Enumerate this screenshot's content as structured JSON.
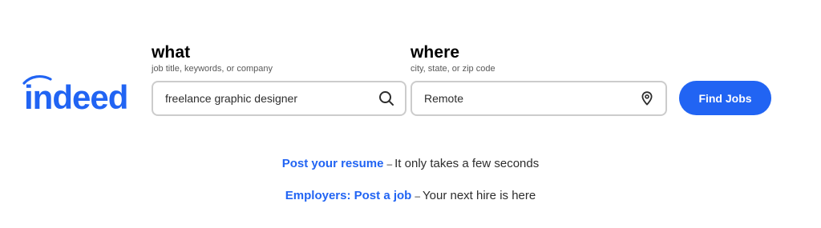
{
  "brand": {
    "logo_text": "indeed",
    "color": "#2164f3"
  },
  "search": {
    "what": {
      "label": "what",
      "hint": "job title, keywords, or company",
      "value": "freelance graphic designer",
      "icon": "search-icon"
    },
    "where": {
      "label": "where",
      "hint": "city, state, or zip code",
      "value": "Remote",
      "icon": "location-pin-icon"
    },
    "submit_label": "Find Jobs"
  },
  "promos": {
    "resume": {
      "link": "Post your resume",
      "dash": "–",
      "text": "It only takes a few seconds"
    },
    "employer": {
      "link": "Employers: Post a job",
      "dash": "–",
      "text": "Your next hire is here"
    }
  },
  "colors": {
    "accent": "#2164f3",
    "text": "#2d2d2d",
    "border": "#cccccc"
  }
}
